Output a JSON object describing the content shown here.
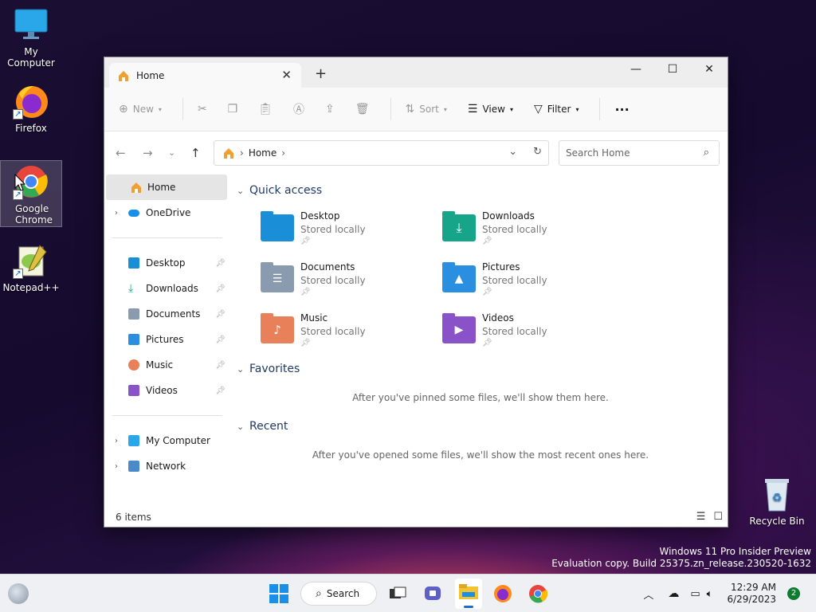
{
  "desktop": {
    "icons": [
      {
        "label": "My Computer"
      },
      {
        "label": "Firefox"
      },
      {
        "label": "Google Chrome"
      },
      {
        "label": "Notepad++"
      },
      {
        "label": "Recycle Bin"
      }
    ]
  },
  "window": {
    "tab_title": "Home",
    "toolbar": {
      "new_label": "New",
      "sort_label": "Sort",
      "view_label": "View",
      "filter_label": "Filter",
      "more_label": "···"
    },
    "address": {
      "crumb": "Home"
    },
    "search_placeholder": "Search Home",
    "sidebar": {
      "top": [
        {
          "label": "Home"
        },
        {
          "label": "OneDrive"
        }
      ],
      "pinned": [
        {
          "label": "Desktop"
        },
        {
          "label": "Downloads"
        },
        {
          "label": "Documents"
        },
        {
          "label": "Pictures"
        },
        {
          "label": "Music"
        },
        {
          "label": "Videos"
        }
      ],
      "bottom": [
        {
          "label": "My Computer"
        },
        {
          "label": "Network"
        }
      ]
    },
    "sections": {
      "quick_access": "Quick access",
      "favorites": "Favorites",
      "recent": "Recent",
      "favorites_empty": "After you've pinned some files, we'll show them here.",
      "recent_empty": "After you've opened some files, we'll show the most recent ones here."
    },
    "quick_access_items": [
      {
        "name": "Desktop",
        "status": "Stored locally",
        "color": "#1a8fd8"
      },
      {
        "name": "Downloads",
        "status": "Stored locally",
        "color": "#17a589"
      },
      {
        "name": "Documents",
        "status": "Stored locally",
        "color": "#8a9bb0"
      },
      {
        "name": "Pictures",
        "status": "Stored locally",
        "color": "#2a8fe0"
      },
      {
        "name": "Music",
        "status": "Stored locally",
        "color": "#e8805a"
      },
      {
        "name": "Videos",
        "status": "Stored locally",
        "color": "#8a52c8"
      }
    ],
    "status_text": "6 items"
  },
  "watermark": {
    "line1": "Windows 11 Pro Insider Preview",
    "line2": "Evaluation copy. Build 25375.zn_release.230520-1632"
  },
  "taskbar": {
    "search_label": "Search",
    "time": "12:29 AM",
    "date": "6/29/2023",
    "notification_count": "2"
  }
}
